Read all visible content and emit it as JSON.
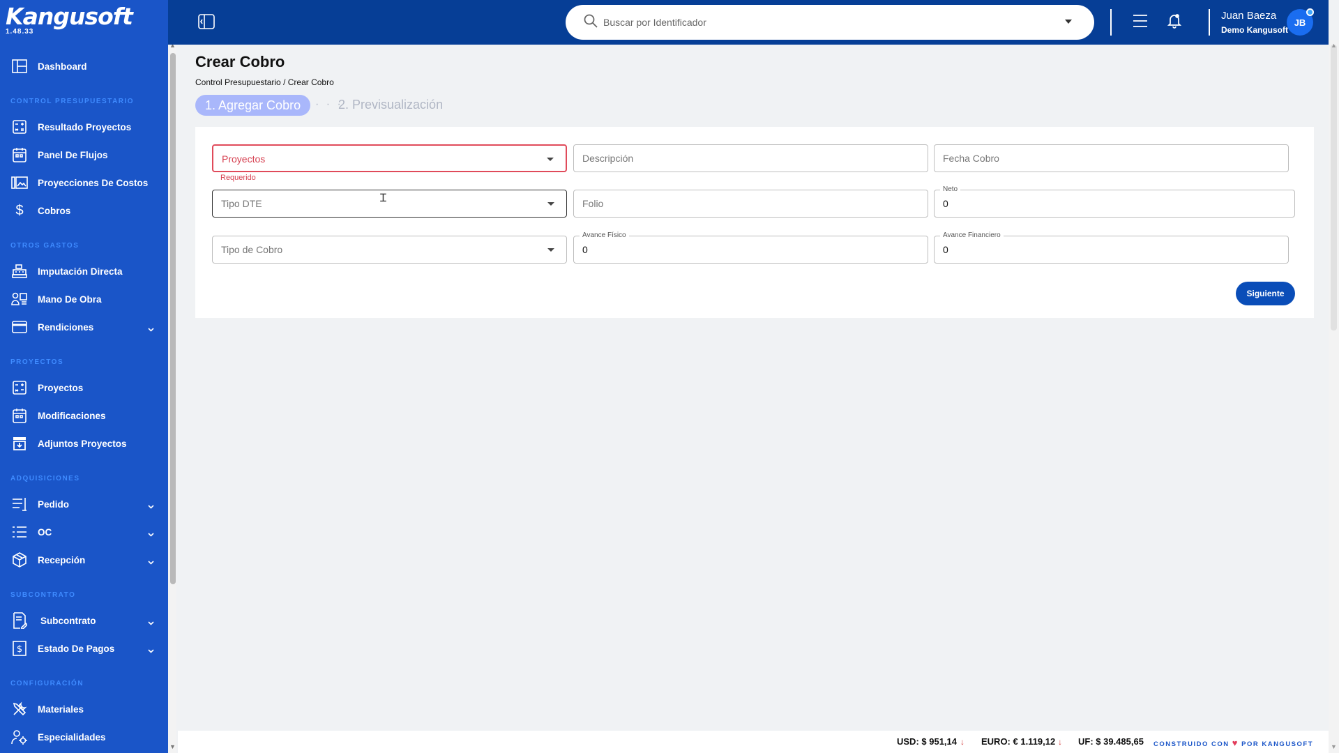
{
  "app": {
    "logo": "Kangusoft",
    "version": "1.48.33"
  },
  "sidebar": {
    "dashboard": "Dashboard",
    "sections": {
      "control": "CONTROL PRESUPUESTARIO",
      "otros": "OTROS GASTOS",
      "proyectos": "PROYECTOS",
      "adquisiciones": "ADQUISICIONES",
      "subcontrato": "SUBCONTRATO",
      "configuracion": "CONFIGURACIÓN"
    },
    "items": {
      "resultado": "Resultado Proyectos",
      "panel": "Panel De Flujos",
      "proyecciones": "Proyecciones De Costos",
      "cobros": "Cobros",
      "imputacion": "Imputación Directa",
      "mano": "Mano De Obra",
      "rendiciones": "Rendiciones",
      "proyectos": "Proyectos",
      "modificaciones": "Modificaciones",
      "adjuntos": "Adjuntos Proyectos",
      "pedido": "Pedido",
      "oc": "OC",
      "recepcion": "Recepción",
      "subcontrato": "Subcontrato",
      "estado": "Estado De Pagos",
      "materiales": "Materiales",
      "especialidades": "Especialidades"
    }
  },
  "header": {
    "search_placeholder": "Buscar por Identificador",
    "user_name": "Juan Baeza",
    "user_org": "Demo Kangusoft",
    "avatar_initials": "JB"
  },
  "page": {
    "title": "Crear Cobro",
    "breadcrumb": "Control Presupuestario / Crear Cobro",
    "step1": "1. Agregar Cobro",
    "step_dots": "· · ·",
    "step2": "2. Previsualización"
  },
  "form": {
    "proyectos": "Proyectos",
    "proyectos_error": "Requerido",
    "descripcion": "Descripción",
    "fecha": "Fecha Cobro",
    "tipo_dte": "Tipo DTE",
    "folio": "Folio",
    "neto_label": "Neto",
    "neto_value": "0",
    "tipo_cobro": "Tipo de Cobro",
    "avance_fisico_label": "Avance Físico",
    "avance_fisico_value": "0",
    "avance_financiero_label": "Avance Financiero",
    "avance_financiero_value": "0",
    "next": "Siguiente"
  },
  "footer": {
    "usd": "USD: $ 951,14",
    "euro": "EURO: € 1.119,12",
    "uf": "UF: $ 39.485,65",
    "built_a": "CONSTRUIDO CON",
    "built_b": "POR KANGUSOFT"
  },
  "colors": {
    "sidebar": "#1a55c8",
    "topbar": "#063e96",
    "primary_button": "#0a4db8",
    "error": "#e04a5a",
    "step_active": "#a9b7fb"
  }
}
